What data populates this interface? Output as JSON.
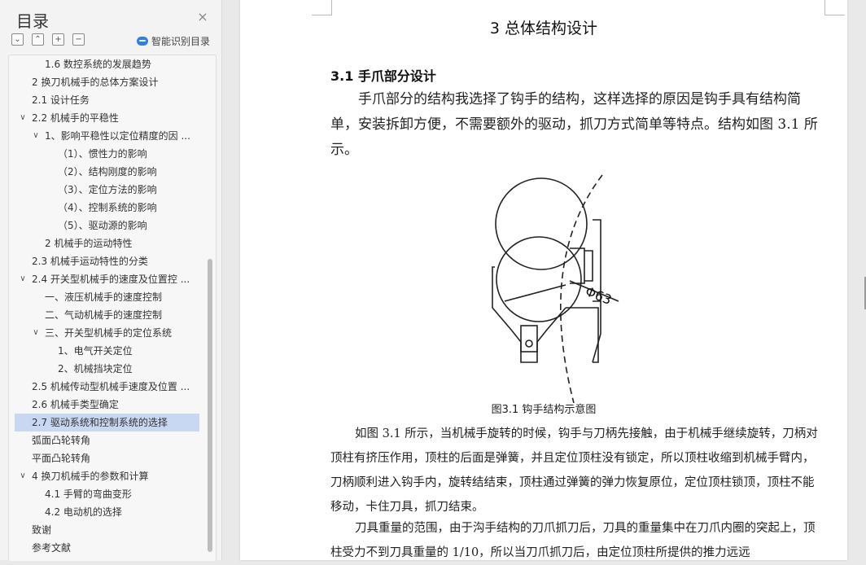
{
  "sidebar": {
    "title": "目录",
    "close_icon": "×",
    "tools": [
      "⌄",
      "⌃",
      "+",
      "−"
    ],
    "smart_label": "智能识别目录",
    "items": [
      {
        "label": "1.6 数控系统的发展趋势",
        "level": 2,
        "chevron": ""
      },
      {
        "label": "2 换刀机械手的总体方案设计",
        "level": 1,
        "chevron": ""
      },
      {
        "label": "2.1 设计任务",
        "level": 1,
        "chevron": ""
      },
      {
        "label": "2.2 机械手的平稳性",
        "level": 1,
        "chevron": "∨"
      },
      {
        "label": "1、影响平稳性以定位精度的因 ...",
        "level": 2,
        "chevron": "∨"
      },
      {
        "label": "（1）、惯性力的影响",
        "level": 3,
        "chevron": ""
      },
      {
        "label": "（2）、结构刚度的影响",
        "level": 3,
        "chevron": ""
      },
      {
        "label": "（3）、定位方法的影响",
        "level": 3,
        "chevron": ""
      },
      {
        "label": "（4）、控制系统的影响",
        "level": 3,
        "chevron": ""
      },
      {
        "label": "（5）、驱动源的影响",
        "level": 3,
        "chevron": ""
      },
      {
        "label": "2  机械手的运动特性",
        "level": 2,
        "chevron": ""
      },
      {
        "label": "2.3 机械手运动特性的分类",
        "level": 1,
        "chevron": ""
      },
      {
        "label": "2.4 开关型机械手的速度及位置控 ...",
        "level": 1,
        "chevron": "∨"
      },
      {
        "label": "一、液压机械手的速度控制",
        "level": 2,
        "chevron": ""
      },
      {
        "label": "二、气动机械手的速度控制",
        "level": 2,
        "chevron": ""
      },
      {
        "label": "三、开关型机械手的定位系统",
        "level": 2,
        "chevron": "∨"
      },
      {
        "label": "1、电气开关定位",
        "level": 3,
        "chevron": ""
      },
      {
        "label": "2、机械挡块定位",
        "level": 3,
        "chevron": ""
      },
      {
        "label": "2.5 机械传动型机械手速度及位置 ...",
        "level": 1,
        "chevron": ""
      },
      {
        "label": "2.6  机械手类型确定",
        "level": 1,
        "chevron": ""
      },
      {
        "label": "2.7  驱动系统和控制系统的选择",
        "level": 1,
        "chevron": "",
        "active": true
      },
      {
        "label": "弧面凸轮转角",
        "level": 1,
        "chevron": ""
      },
      {
        "label": "平面凸轮转角",
        "level": 1,
        "chevron": ""
      },
      {
        "label": "4 换刀机械手的参数和计算",
        "level": 1,
        "chevron": "∨"
      },
      {
        "label": "4.1 手臂的弯曲变形",
        "level": 2,
        "chevron": ""
      },
      {
        "label": "4.2  电动机的选择",
        "level": 2,
        "chevron": ""
      },
      {
        "label": "致谢",
        "level": 1,
        "chevron": ""
      },
      {
        "label": "参考文献",
        "level": 1,
        "chevron": ""
      }
    ]
  },
  "document": {
    "chapter_title": "3  总体结构设计",
    "section_title": "3.1  手爪部分设计",
    "paragraph1": "手爪部分的结构我选择了钩手的结构，这样选择的原因是钩手具有结构简单，安装拆卸方便，不需要额外的驱动，抓刀方式简单等特点。结构如图 3.1 所示。",
    "figure_label": "Φ63",
    "figure_caption": "图3.1  钩手结构示意图",
    "paragraph2": "如图 3.1 所示，当机械手旋转的时候，钩手与刀柄先接触，由于机械手继续旋转，刀柄对顶柱有挤压作用，顶柱的后面是弹簧，并且定位顶柱没有锁定，所以顶柱收缩到机械手臂内，刀柄顺利进入钩手内，旋转结结束，顶柱通过弹簧的弹力恢复原位，定位顶柱锁顶，顶柱不能移动，卡住刀具，抓刀结束。",
    "paragraph3": "刀具重量的范围，由于沟手结构的刀爪抓刀后，刀具的重量集中在刀爪内圈的突起上，顶柱受力不到刀具重量的 1/10，所以当刀爪抓刀后，由定位顶柱所提供的推力远远"
  }
}
